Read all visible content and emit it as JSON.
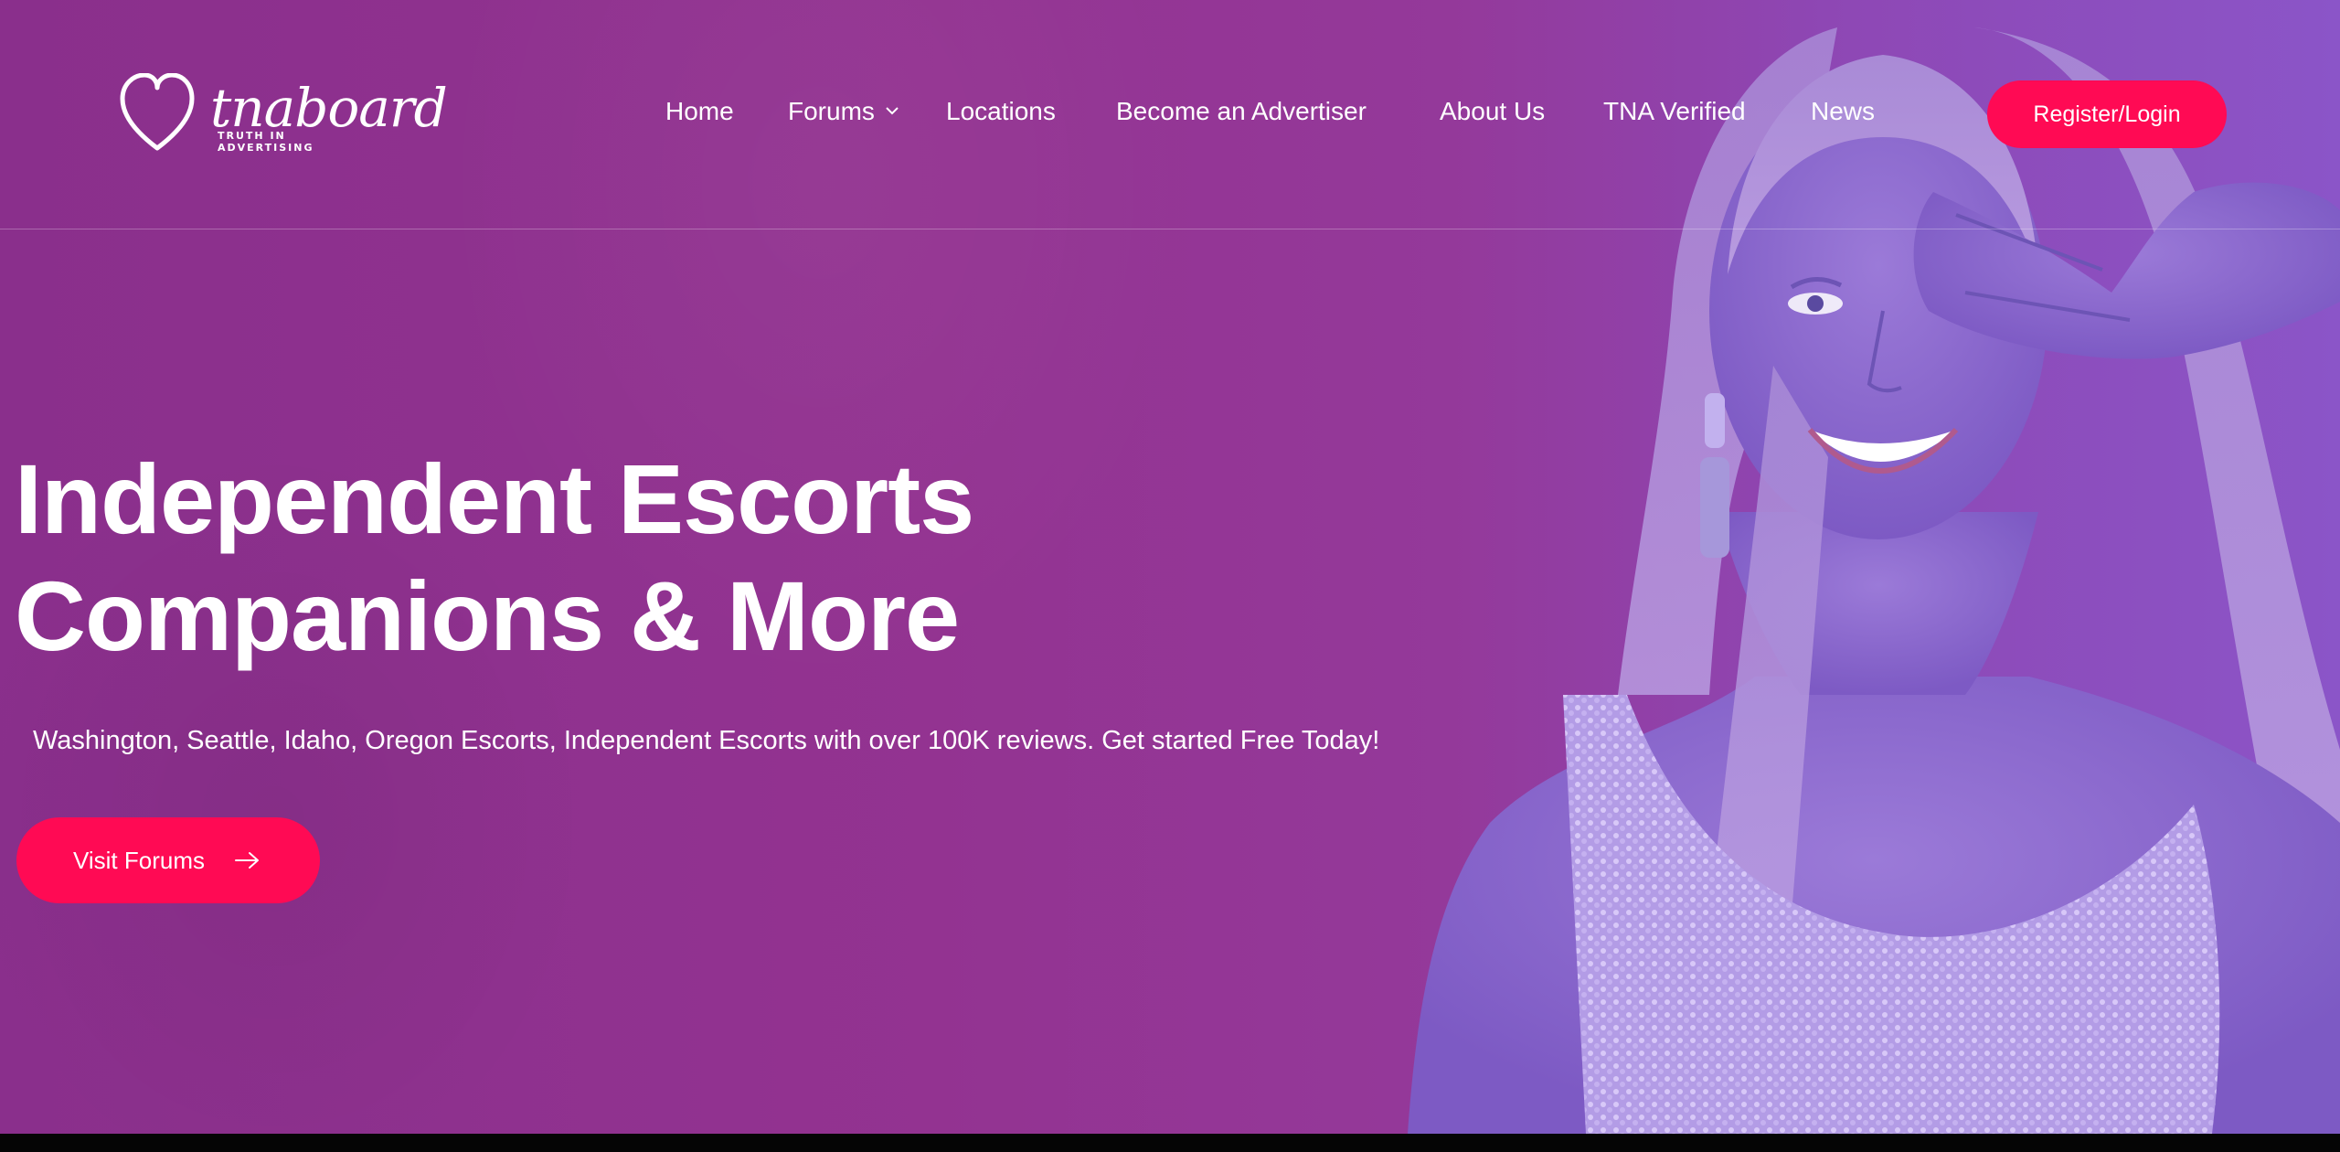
{
  "brand": {
    "name": "tnaboard",
    "tagline": "TRUTH IN ADVERTISING"
  },
  "nav": {
    "items": [
      {
        "label": "Home"
      },
      {
        "label": "Forums",
        "has_dropdown": true
      },
      {
        "label": "Locations"
      },
      {
        "label": "Become an Advertiser"
      },
      {
        "label": "About Us"
      },
      {
        "label": "TNA Verified"
      },
      {
        "label": "News"
      }
    ],
    "cta_label": "Register/Login"
  },
  "hero": {
    "headline_line1": "Independent Escorts",
    "headline_line2": "Companions & More",
    "subline": "Washington, Seattle, Idaho, Oregon Escorts, Independent Escorts with over 100K reviews. Get started Free Today!",
    "cta_label": "Visit Forums"
  },
  "icons": {
    "logo": "heart-outline-icon",
    "dropdown": "chevron-down-icon",
    "cta_arrow": "arrow-right-icon"
  },
  "colors": {
    "overlay_purple": "#933391",
    "overlay_violet": "#8b55c8",
    "accent_pink": "#ff0a54",
    "text": "#ffffff"
  }
}
